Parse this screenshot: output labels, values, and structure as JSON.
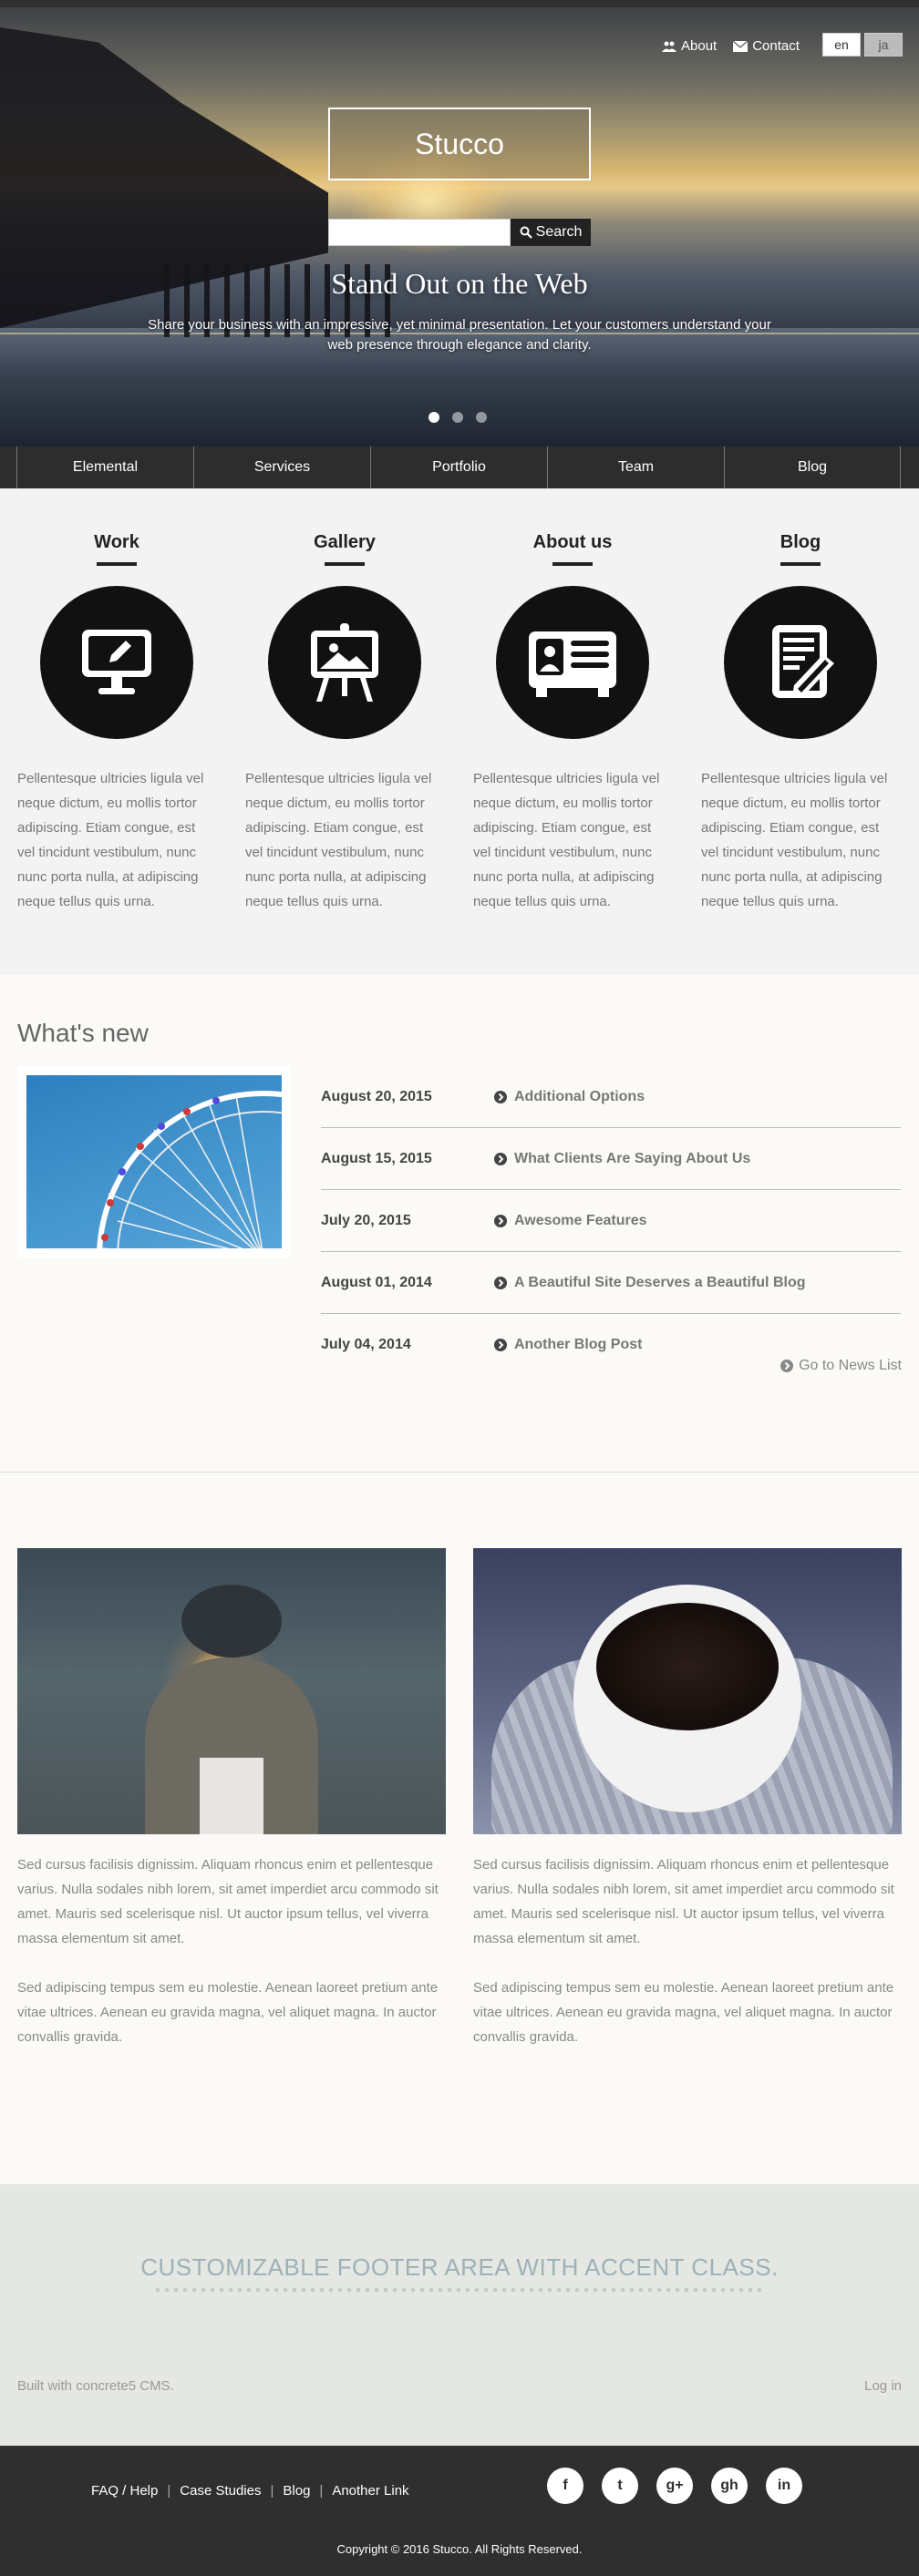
{
  "header": {
    "links": [
      {
        "label": "About",
        "icon": "users-icon"
      },
      {
        "label": "Contact",
        "icon": "envelope-icon"
      }
    ],
    "languages": [
      {
        "label": "en",
        "active": true
      },
      {
        "label": "ja",
        "active": false
      }
    ],
    "site_name": "Stucco",
    "search": {
      "placeholder": "",
      "button_label": "Search"
    }
  },
  "hero": {
    "title": "Stand Out on the Web",
    "subtitle": "Share your business with an impressive, yet minimal presentation. Let your customers understand your web presence through elegance and clarity.",
    "slides": 3,
    "active_slide": 0
  },
  "nav": {
    "items": [
      "Elemental",
      "Services",
      "Portfolio",
      "Team",
      "Blog"
    ]
  },
  "features": [
    {
      "title": "Work",
      "icon": "monitor-pencil-icon",
      "text": "Pellentesque ultricies ligula vel neque dictum, eu mollis tortor adipiscing. Etiam congue, est vel tincidunt vestibulum, nunc nunc porta nulla, at adipiscing neque tellus quis urna."
    },
    {
      "title": "Gallery",
      "icon": "easel-picture-icon",
      "text": "Pellentesque ultricies ligula vel neque dictum, eu mollis tortor adipiscing. Etiam congue, est vel tincidunt vestibulum, nunc nunc porta nulla, at adipiscing neque tellus quis urna."
    },
    {
      "title": "About us",
      "icon": "id-card-icon",
      "text": "Pellentesque ultricies ligula vel neque dictum, eu mollis tortor adipiscing. Etiam congue, est vel tincidunt vestibulum, nunc nunc porta nulla, at adipiscing neque tellus quis urna."
    },
    {
      "title": "Blog",
      "icon": "notepad-pen-icon",
      "text": "Pellentesque ultricies ligula vel neque dictum, eu mollis tortor adipiscing. Etiam congue, est vel tincidunt vestibulum, nunc nunc porta nulla, at adipiscing neque tellus quis urna."
    }
  ],
  "news": {
    "heading": "What's new",
    "items": [
      {
        "date": "August 20, 2015",
        "title": "Additional Options"
      },
      {
        "date": "August 15, 2015",
        "title": "What Clients Are Saying About Us"
      },
      {
        "date": "July 20, 2015",
        "title": "Awesome Features"
      },
      {
        "date": "August 01, 2014",
        "title": "A Beautiful Site Deserves a Beautiful Blog"
      },
      {
        "date": "July 04, 2014",
        "title": "Another Blog Post"
      }
    ],
    "more_label": "Go to News List"
  },
  "photos": [
    {
      "image": "sparkler-photo",
      "p1": "Sed cursus facilisis dignissim. Aliquam rhoncus enim et pellentesque varius. Nulla sodales nibh lorem, sit amet imperdiet arcu commodo sit amet. Mauris sed scelerisque nisl. Ut auctor ipsum tellus, vel viverra massa elementum sit amet.",
      "p2": "Sed adipiscing tempus sem eu molestie. Aenean laoreet pretium ante vitae ultrices. Aenean eu gravida magna, vel aliquet magna. In auctor convallis gravida."
    },
    {
      "image": "coffee-mittens-photo",
      "p1": "Sed cursus facilisis dignissim. Aliquam rhoncus enim et pellentesque varius. Nulla sodales nibh lorem, sit amet imperdiet arcu commodo sit amet. Mauris sed scelerisque nisl. Ut auctor ipsum tellus, vel viverra massa elementum sit amet.",
      "p2": "Sed adipiscing tempus sem eu molestie. Aenean laoreet pretium ante vitae ultrices. Aenean eu gravida magna, vel aliquet magna. In auctor convallis gravida."
    }
  ],
  "footer": {
    "accent_heading": "CUSTOMIZABLE FOOTER AREA WITH ACCENT CLASS.",
    "built_with": "Built with concrete5 CMS.",
    "login": "Log in",
    "links": [
      "FAQ / Help",
      "Case Studies",
      "Blog",
      "Another Link"
    ],
    "socials": [
      {
        "icon": "facebook-icon",
        "glyph": "f"
      },
      {
        "icon": "twitter-icon",
        "glyph": "t"
      },
      {
        "icon": "google-plus-icon",
        "glyph": "g+"
      },
      {
        "icon": "github-icon",
        "glyph": "gh"
      },
      {
        "icon": "linkedin-icon",
        "glyph": "in"
      }
    ],
    "copyright": "Copyright © 2016 Stucco. All Rights Reserved."
  }
}
